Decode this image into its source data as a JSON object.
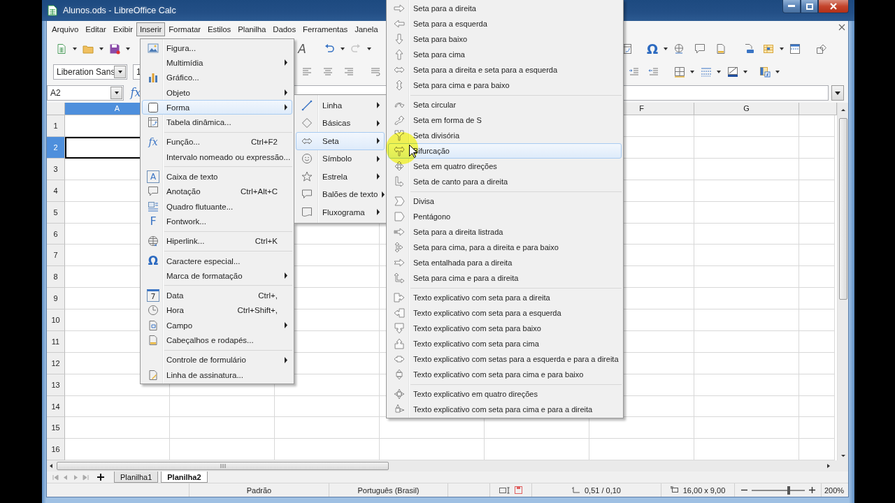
{
  "window": {
    "title": "Alunos.ods - LibreOffice Calc"
  },
  "menu_bar": [
    {
      "label": "Arquivo",
      "selected": false
    },
    {
      "label": "Editar",
      "selected": false
    },
    {
      "label": "Exibir",
      "selected": false
    },
    {
      "label": "Inserir",
      "selected": true
    },
    {
      "label": "Formatar",
      "selected": false
    },
    {
      "label": "Estilos",
      "selected": false
    },
    {
      "label": "Planilha",
      "selected": false
    },
    {
      "label": "Dados",
      "selected": false
    },
    {
      "label": "Ferramentas",
      "selected": false
    },
    {
      "label": "Janela",
      "selected": false
    }
  ],
  "toolbar": {
    "font_color_glyph": "A",
    "special_character_glyph": "Ω",
    "redo_disabled": true
  },
  "format_bar": {
    "font_name": "Liberation Sans",
    "font_size": "1"
  },
  "formula_bar": {
    "name_box": "A2",
    "function_glyph": "fx"
  },
  "sheet": {
    "columns": [
      {
        "label": "A",
        "selected": true
      },
      {
        "label": "F",
        "selected": false
      },
      {
        "label": "G",
        "selected": false
      }
    ],
    "rows": [
      {
        "label": "1",
        "selected": false
      },
      {
        "label": "2",
        "selected": true
      },
      {
        "label": "3",
        "selected": false
      },
      {
        "label": "4",
        "selected": false
      },
      {
        "label": "5",
        "selected": false
      },
      {
        "label": "6",
        "selected": false
      },
      {
        "label": "7",
        "selected": false
      },
      {
        "label": "8",
        "selected": false
      },
      {
        "label": "9",
        "selected": false
      },
      {
        "label": "10",
        "selected": false
      },
      {
        "label": "11",
        "selected": false
      },
      {
        "label": "12",
        "selected": false
      },
      {
        "label": "13",
        "selected": false
      },
      {
        "label": "14",
        "selected": false
      },
      {
        "label": "15",
        "selected": false
      },
      {
        "label": "16",
        "selected": false
      }
    ]
  },
  "sheet_tabs": [
    {
      "label": "Planilha1",
      "selected": false
    },
    {
      "label": "Planilha2",
      "selected": true
    }
  ],
  "status_bar": {
    "style": "Padrão",
    "language": "Português (Brasil)",
    "position": "0,51 / 0,10",
    "size": "16,00 x 9,00",
    "zoom": {
      "level": 0.7
    },
    "zoom_reading": "200%"
  },
  "insert_menu": [
    {
      "kind": "item",
      "label": "Figura...",
      "submenu": false,
      "highlighted": false
    },
    {
      "kind": "item",
      "label": "Multimídia",
      "submenu": true,
      "highlighted": false
    },
    {
      "kind": "item",
      "label": "Gráfico...",
      "submenu": false,
      "highlighted": false
    },
    {
      "kind": "item",
      "label": "Objeto",
      "submenu": true,
      "highlighted": false
    },
    {
      "kind": "item",
      "label": "Forma",
      "submenu": true,
      "highlighted": true
    },
    {
      "kind": "item",
      "label": "Tabela dinâmica...",
      "submenu": false,
      "highlighted": false
    },
    {
      "kind": "separator"
    },
    {
      "kind": "item",
      "label": "Função...",
      "shortcut": "Ctrl+F2",
      "glyph": "fx",
      "submenu": false,
      "highlighted": false
    },
    {
      "kind": "item",
      "label": "Intervalo nomeado ou expressão...",
      "submenu": false,
      "highlighted": false
    },
    {
      "kind": "separator"
    },
    {
      "kind": "item",
      "label": "Caixa de texto",
      "glyph": "A",
      "submenu": false,
      "highlighted": false
    },
    {
      "kind": "item",
      "label": "Anotação",
      "shortcut": "Ctrl+Alt+C",
      "submenu": false,
      "highlighted": false
    },
    {
      "kind": "item",
      "label": "Quadro flutuante...",
      "submenu": false,
      "highlighted": false
    },
    {
      "kind": "item",
      "label": "Fontwork...",
      "glyph": "F",
      "submenu": false,
      "highlighted": false
    },
    {
      "kind": "separator"
    },
    {
      "kind": "item",
      "label": "Hiperlink...",
      "shortcut": "Ctrl+K",
      "submenu": false,
      "highlighted": false
    },
    {
      "kind": "separator"
    },
    {
      "kind": "item",
      "label": "Caractere especial...",
      "glyph": "Ω",
      "submenu": false,
      "highlighted": false
    },
    {
      "kind": "item",
      "label": "Marca de formatação",
      "submenu": true,
      "highlighted": false
    },
    {
      "kind": "separator"
    },
    {
      "kind": "item",
      "label": "Data",
      "shortcut": "Ctrl+,",
      "glyph": "7",
      "submenu": false,
      "highlighted": false
    },
    {
      "kind": "item",
      "label": "Hora",
      "shortcut": "Ctrl+Shift+,",
      "submenu": false,
      "highlighted": false
    },
    {
      "kind": "item",
      "label": "Campo",
      "submenu": true,
      "highlighted": false
    },
    {
      "kind": "item",
      "label": "Cabeçalhos e rodapés...",
      "submenu": false,
      "highlighted": false
    },
    {
      "kind": "separator"
    },
    {
      "kind": "item",
      "label": "Controle de formulário",
      "submenu": true,
      "highlighted": false
    },
    {
      "kind": "item",
      "label": "Linha de assinatura...",
      "submenu": false,
      "highlighted": false
    }
  ],
  "shape_menu": [
    {
      "label": "Linha",
      "highlighted": false
    },
    {
      "label": "Básicas",
      "highlighted": false
    },
    {
      "label": "Seta",
      "highlighted": true
    },
    {
      "label": "Símbolo",
      "highlighted": false
    },
    {
      "label": "Estrela",
      "highlighted": false
    },
    {
      "label": "Balões de texto",
      "highlighted": false
    },
    {
      "label": "Fluxograma",
      "highlighted": false
    }
  ],
  "arrow_menu": [
    {
      "kind": "item",
      "label": "Seta para a direita",
      "highlighted": false
    },
    {
      "kind": "item",
      "label": "Seta para a esquerda",
      "highlighted": false
    },
    {
      "kind": "item",
      "label": "Seta para baixo",
      "highlighted": false
    },
    {
      "kind": "item",
      "label": "Seta para cima",
      "highlighted": false
    },
    {
      "kind": "item",
      "label": "Seta para a direita e seta para a esquerda",
      "highlighted": false
    },
    {
      "kind": "item",
      "label": "Seta para cima e para baixo",
      "highlighted": false
    },
    {
      "kind": "separator"
    },
    {
      "kind": "item",
      "label": "Seta circular",
      "highlighted": false
    },
    {
      "kind": "item",
      "label": "Seta em forma de S",
      "highlighted": false
    },
    {
      "kind": "item",
      "label": "Seta divisória",
      "highlighted": false
    },
    {
      "kind": "item",
      "label": "Bifurcação",
      "highlighted": true
    },
    {
      "kind": "item",
      "label": "Seta em quatro direções",
      "highlighted": false
    },
    {
      "kind": "item",
      "label": "Seta de canto para a direita",
      "highlighted": false
    },
    {
      "kind": "separator"
    },
    {
      "kind": "item",
      "label": "Divisa",
      "highlighted": false
    },
    {
      "kind": "item",
      "label": "Pentágono",
      "highlighted": false
    },
    {
      "kind": "item",
      "label": "Seta para a direita listrada",
      "highlighted": false
    },
    {
      "kind": "item",
      "label": "Seta para cima, para a direita e para baixo",
      "highlighted": false
    },
    {
      "kind": "item",
      "label": "Seta entalhada para a direita",
      "highlighted": false
    },
    {
      "kind": "item",
      "label": "Seta para cima e para a direita",
      "highlighted": false
    },
    {
      "kind": "separator"
    },
    {
      "kind": "item",
      "label": "Texto explicativo com seta para a direita",
      "highlighted": false
    },
    {
      "kind": "item",
      "label": "Texto explicativo com seta para a esquerda",
      "highlighted": false
    },
    {
      "kind": "item",
      "label": "Texto explicativo com seta para baixo",
      "highlighted": false
    },
    {
      "kind": "item",
      "label": "Texto explicativo com seta para cima",
      "highlighted": false
    },
    {
      "kind": "item",
      "label": "Texto explicativo com setas para a esquerda e para a direita",
      "highlighted": false
    },
    {
      "kind": "item",
      "label": "Texto explicativo com seta para cima e para baixo",
      "highlighted": false
    },
    {
      "kind": "separator"
    },
    {
      "kind": "item",
      "label": "Texto explicativo em quatro direções",
      "highlighted": false
    },
    {
      "kind": "item",
      "label": "Texto explicativo com seta para cima e para a direita",
      "highlighted": false
    }
  ]
}
